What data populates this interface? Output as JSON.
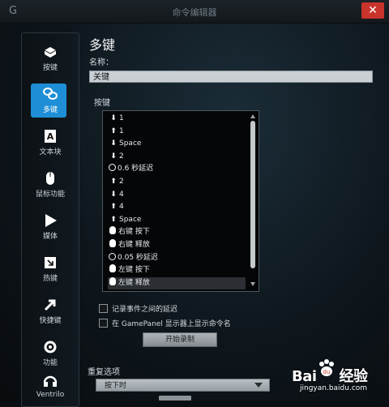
{
  "window": {
    "title": "命令编辑器",
    "close_symbol": "✕"
  },
  "sidebar": {
    "items": [
      {
        "label": "按键",
        "icon": "keyboard-key-icon"
      },
      {
        "label": "多键",
        "icon": "multi-key-icon",
        "active": true
      },
      {
        "label": "文本块",
        "icon": "text-block-icon"
      },
      {
        "label": "鼠标功能",
        "icon": "mouse-icon"
      },
      {
        "label": "媒体",
        "icon": "play-icon"
      },
      {
        "label": "热键",
        "icon": "hotkey-icon"
      },
      {
        "label": "快捷键",
        "icon": "shortcut-arrow-icon"
      },
      {
        "label": "功能",
        "icon": "gear-icon"
      },
      {
        "label": "Ventrilo",
        "icon": "headset-icon"
      }
    ]
  },
  "editor": {
    "heading": "多键",
    "name_label": "名称：",
    "name_value": "关键",
    "keys_label": "按键",
    "keys": [
      {
        "icon": "down",
        "text": "1"
      },
      {
        "icon": "up",
        "text": "1"
      },
      {
        "icon": "down",
        "text": "Space"
      },
      {
        "icon": "down",
        "text": "2"
      },
      {
        "icon": "clock",
        "text": "0.6 秒延迟"
      },
      {
        "icon": "up",
        "text": "2"
      },
      {
        "icon": "down",
        "text": "4"
      },
      {
        "icon": "up",
        "text": "4"
      },
      {
        "icon": "up",
        "text": "Space"
      },
      {
        "icon": "mouse",
        "text": "右键 按下"
      },
      {
        "icon": "mouse",
        "text": "右键 释放"
      },
      {
        "icon": "clock",
        "text": "0.05 秒延迟"
      },
      {
        "icon": "mouse",
        "text": "左键 按下"
      },
      {
        "icon": "mouse",
        "text": "左键 释放",
        "selected": true
      }
    ],
    "record_delays_label": "记录事件之间的延迟",
    "gamepanel_label": "在 GamePanel 显示器上显示命令名",
    "record_button": "开始录制",
    "repeat_section_label": "重复选项",
    "repeat_value": "按下时"
  },
  "watermark": {
    "brand": "Bai",
    "brand_suffix": "经验",
    "url": "jingyan.baidu.com"
  },
  "colors": {
    "accent": "#1e8fd6",
    "close": "#c8342c"
  }
}
